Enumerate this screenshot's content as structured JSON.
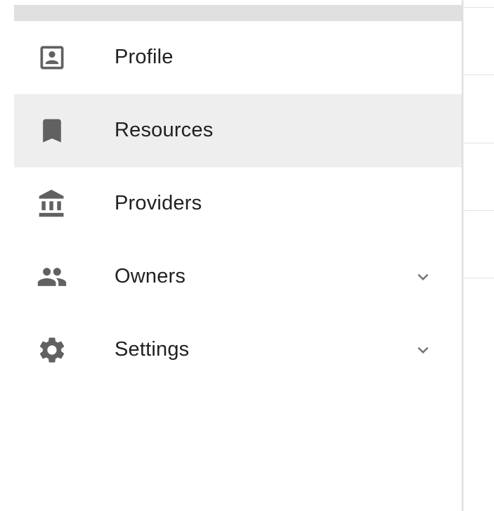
{
  "drawer": {
    "items": [
      {
        "label": "Profile",
        "icon": "account-box-icon",
        "expandable": false,
        "active": false
      },
      {
        "label": "Resources",
        "icon": "bookmark-icon",
        "expandable": false,
        "active": true
      },
      {
        "label": "Providers",
        "icon": "bank-icon",
        "expandable": false,
        "active": false
      },
      {
        "label": "Owners",
        "icon": "people-icon",
        "expandable": true,
        "active": false
      },
      {
        "label": "Settings",
        "icon": "gear-icon",
        "expandable": true,
        "active": false
      }
    ],
    "colors": {
      "active_background": "#eeeeee",
      "icon": "#616161",
      "text": "#212121",
      "header_bar": "#e0e0e0"
    }
  }
}
